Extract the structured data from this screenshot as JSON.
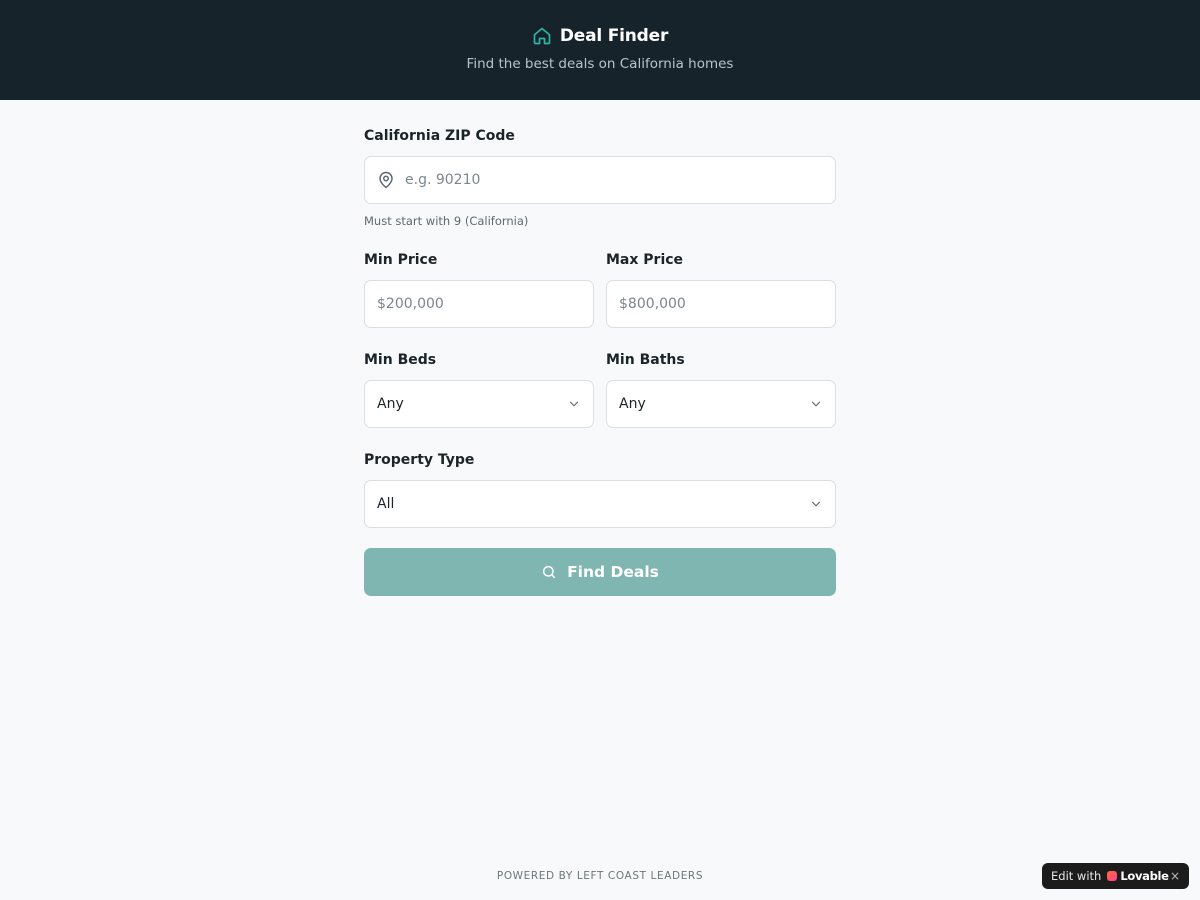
{
  "header": {
    "icon": "home-icon",
    "title": "Deal Finder",
    "subtitle": "Find the best deals on California homes",
    "accent_color": "#2fb5a3",
    "background": "#17232a"
  },
  "form": {
    "zip": {
      "label": "California ZIP Code",
      "icon": "map-pin-icon",
      "placeholder": "e.g. 90210",
      "value": "",
      "hint": "Must start with 9 (California)"
    },
    "min_price": {
      "label": "Min Price",
      "placeholder": "$200,000",
      "value": ""
    },
    "max_price": {
      "label": "Max Price",
      "placeholder": "$800,000",
      "value": ""
    },
    "min_beds": {
      "label": "Min Beds",
      "selected": "Any"
    },
    "min_baths": {
      "label": "Min Baths",
      "selected": "Any"
    },
    "property_type": {
      "label": "Property Type",
      "selected": "All"
    },
    "submit": {
      "label": "Find Deals",
      "icon": "search-icon",
      "color": "#7fb6b1"
    }
  },
  "footer": {
    "text": "POWERED BY LEFT COAST LEADERS"
  },
  "badge": {
    "prefix": "Edit with",
    "brand": "Lovable",
    "close": "×"
  }
}
